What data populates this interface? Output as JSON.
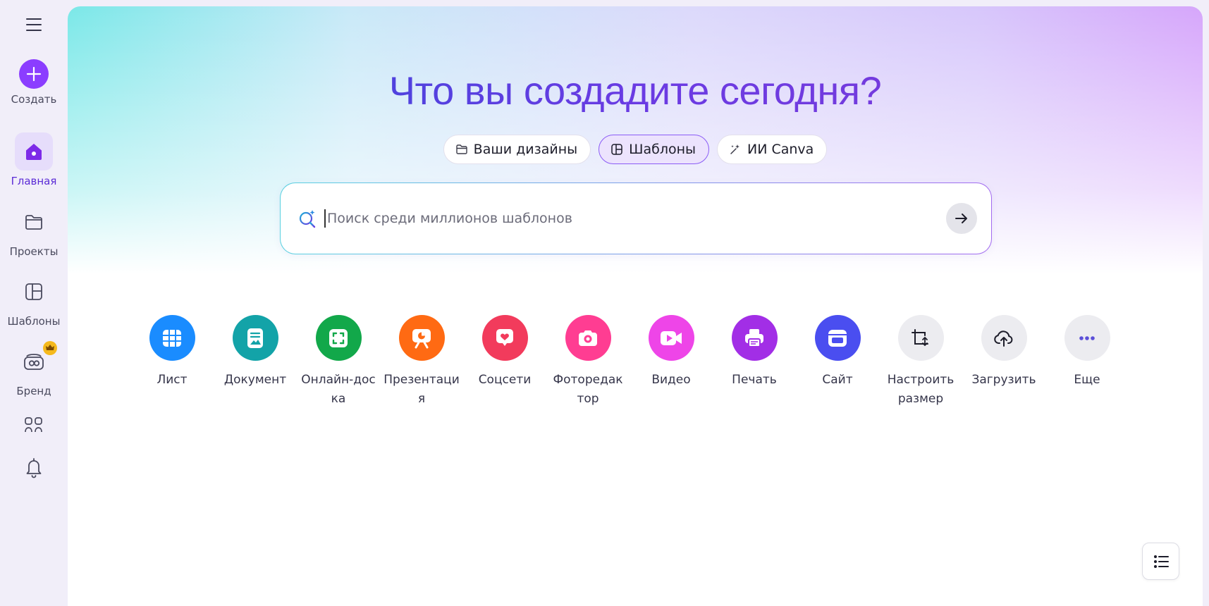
{
  "sidebar": {
    "create_label": "Создать",
    "items": [
      {
        "label": "Главная",
        "icon": "home-icon",
        "active": true
      },
      {
        "label": "Проекты",
        "icon": "folder-icon"
      },
      {
        "label": "Шаблоны",
        "icon": "templates-icon"
      },
      {
        "label": "Бренд",
        "icon": "brand-icon",
        "badge": "crown"
      }
    ]
  },
  "hero": {
    "headline": "Что вы создадите сегодня?"
  },
  "tabs": [
    {
      "label": "Ваши дизайны",
      "icon": "folder-icon"
    },
    {
      "label": "Шаблоны",
      "icon": "templates-icon",
      "active": true
    },
    {
      "label": "ИИ Canva",
      "icon": "sparkle-icon"
    }
  ],
  "search": {
    "placeholder": "Поиск среди миллионов шаблонов",
    "value": ""
  },
  "shortcuts": [
    {
      "label": "Лист",
      "color": "#1a8cff",
      "icon": "sheet-icon"
    },
    {
      "label": "Документ",
      "color": "#13a3a8",
      "icon": "document-icon"
    },
    {
      "label": "Онлайн-доска",
      "color": "#12a84a",
      "icon": "whiteboard-icon"
    },
    {
      "label": "Презентация",
      "color": "#ff6a13",
      "icon": "presentation-icon"
    },
    {
      "label": "Соцсети",
      "color": "#f23b5c",
      "icon": "social-heart-icon"
    },
    {
      "label": "Фоторедактор",
      "color": "#ff3d92",
      "icon": "camera-icon"
    },
    {
      "label": "Видео",
      "color": "#ee45e8",
      "icon": "video-icon"
    },
    {
      "label": "Печать",
      "color": "#a22ee6",
      "icon": "printer-icon"
    },
    {
      "label": "Сайт",
      "color": "#4a4ef0",
      "icon": "website-icon"
    },
    {
      "label": "Настроить размер",
      "color": "#ececf0",
      "icon": "resize-icon"
    },
    {
      "label": "Загрузить",
      "color": "#ececf0",
      "icon": "upload-icon"
    },
    {
      "label": "Еще",
      "color": "#ececf0",
      "icon": "more-icon"
    }
  ]
}
